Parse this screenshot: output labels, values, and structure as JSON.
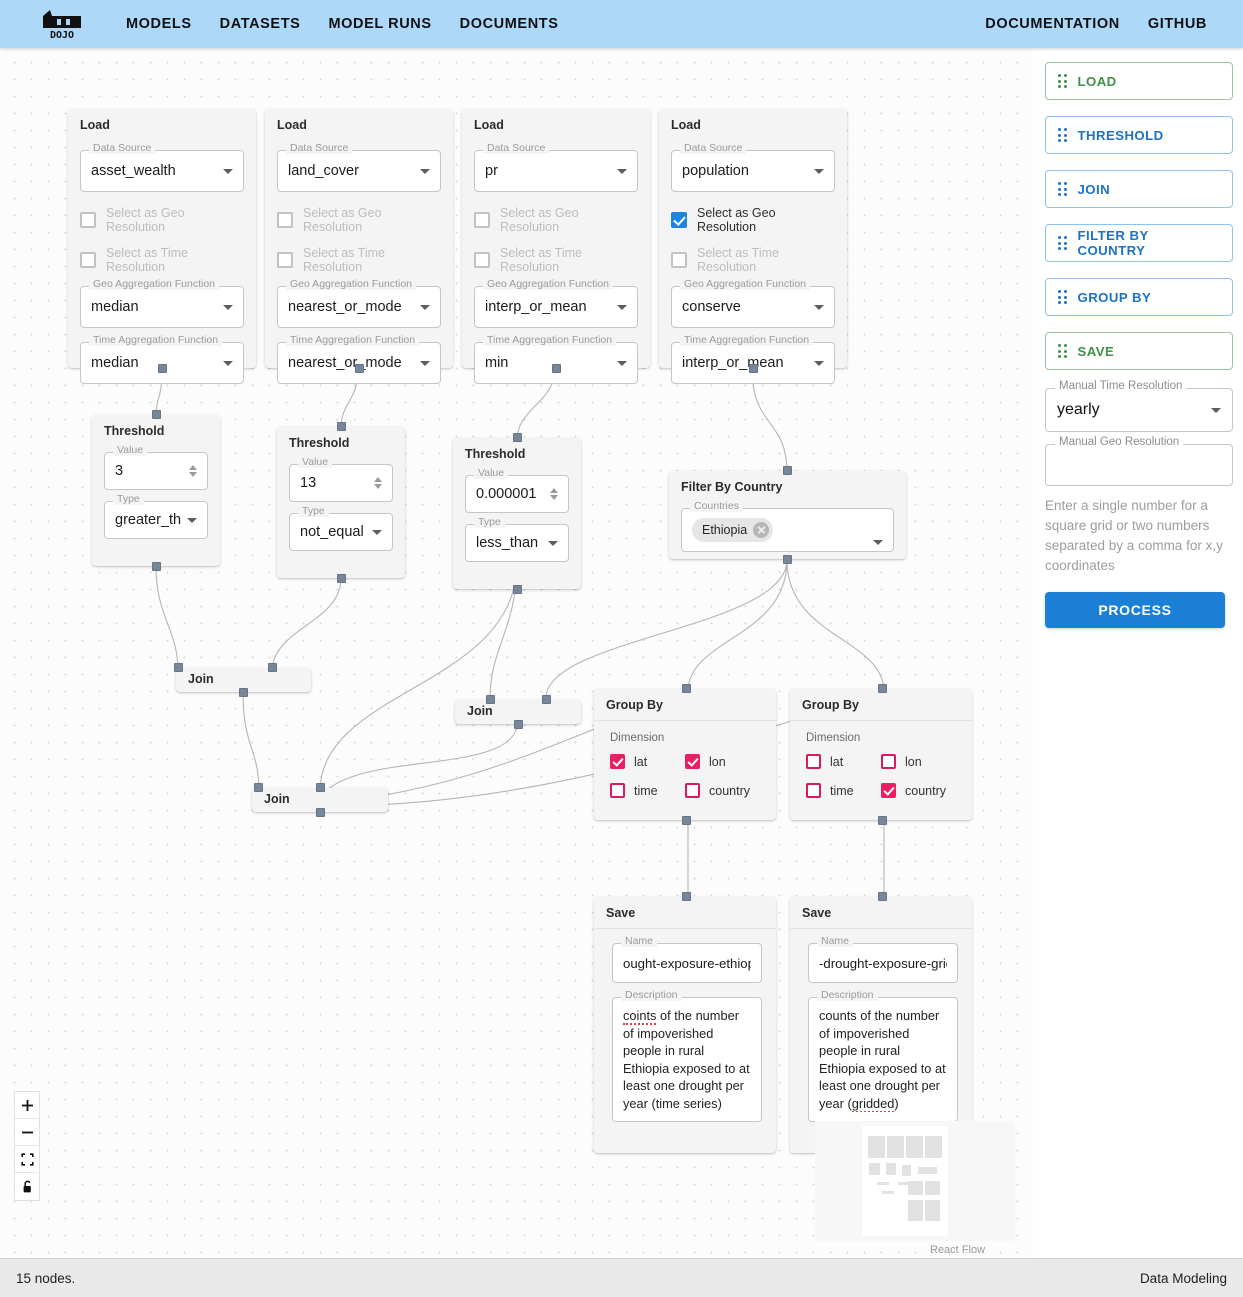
{
  "header": {
    "logo_alt": "DOJO",
    "nav_left": [
      "MODELS",
      "DATASETS",
      "MODEL RUNS",
      "DOCUMENTS"
    ],
    "nav_right": [
      "DOCUMENTATION",
      "GITHUB"
    ],
    "bg_color": "#aed8f7"
  },
  "sidebar": {
    "palette": [
      {
        "label": "LOAD",
        "tone": "green"
      },
      {
        "label": "THRESHOLD",
        "tone": "blue"
      },
      {
        "label": "JOIN",
        "tone": "blue"
      },
      {
        "label": "FILTER BY COUNTRY",
        "tone": "blue"
      },
      {
        "label": "GROUP BY",
        "tone": "blue"
      },
      {
        "label": "SAVE",
        "tone": "green"
      }
    ],
    "time_resolution": {
      "label": "Manual Time Resolution",
      "value": "yearly"
    },
    "geo_resolution": {
      "label": "Manual Geo Resolution",
      "value": "",
      "placeholder": ""
    },
    "help_text": "Enter a single number for a square grid or two numbers separated by a comma for x,y coordinates",
    "process_label": "PROCESS",
    "process_color": "#1c7fd6"
  },
  "canvas": {
    "field_labels": {
      "data_source": "Data Source",
      "geo_res": "Select as Geo Resolution",
      "time_res": "Select as Time Resolution",
      "geo_agg": "Geo Aggregation Function",
      "time_agg": "Time Aggregation Function",
      "value": "Value",
      "type": "Type",
      "countries": "Countries",
      "dimension": "Dimension",
      "name": "Name",
      "description": "Description"
    },
    "load_nodes": [
      {
        "title": "Load",
        "data_source": "asset_wealth",
        "geo_checked": false,
        "time_checked": false,
        "geo_agg": "median",
        "time_agg": "median"
      },
      {
        "title": "Load",
        "data_source": "land_cover",
        "geo_checked": false,
        "time_checked": false,
        "geo_agg": "nearest_or_mode",
        "time_agg": "nearest_or_mode"
      },
      {
        "title": "Load",
        "data_source": "pr",
        "geo_checked": false,
        "time_checked": false,
        "geo_agg": "interp_or_mean",
        "time_agg": "min"
      },
      {
        "title": "Load",
        "data_source": "population",
        "geo_checked": true,
        "time_checked": false,
        "geo_agg": "conserve",
        "time_agg": "interp_or_mean"
      }
    ],
    "threshold_nodes": [
      {
        "title": "Threshold",
        "value": "3",
        "type": "greater_than_"
      },
      {
        "title": "Threshold",
        "value": "13",
        "type": "not_equal"
      },
      {
        "title": "Threshold",
        "value": "0.000001",
        "type": "less_than"
      }
    ],
    "filter_node": {
      "title": "Filter By Country",
      "country": "Ethiopia"
    },
    "join_nodes": [
      {
        "title": "Join"
      },
      {
        "title": "Join"
      },
      {
        "title": "Join"
      }
    ],
    "group_by_nodes": [
      {
        "title": "Group By",
        "dims": [
          {
            "label": "lat",
            "on": true
          },
          {
            "label": "lon",
            "on": true
          },
          {
            "label": "time",
            "on": false
          },
          {
            "label": "country",
            "on": false
          }
        ]
      },
      {
        "title": "Group By",
        "dims": [
          {
            "label": "lat",
            "on": false
          },
          {
            "label": "lon",
            "on": false
          },
          {
            "label": "time",
            "on": false
          },
          {
            "label": "country",
            "on": true
          }
        ]
      }
    ],
    "save_nodes": [
      {
        "title": "Save",
        "name": "ought-exposure-ethiopia-ti",
        "desc_misspelled": "coints",
        "desc_rest": " of the number of impoverished people in rural Ethiopia exposed to at least one drought per year (time series)"
      },
      {
        "title": "Save",
        "name": "-drought-exposure-gridded",
        "desc_lead": "counts of the number of impoverished people in rural Ethiopia exposed to at least one drought per year (",
        "desc_misspelled": "gridded",
        "desc_tail": ")"
      }
    ],
    "controls": [
      "zoom-in",
      "zoom-out",
      "fit-view",
      "lock"
    ],
    "attribution": "React Flow"
  },
  "statusbar": {
    "left": "15 nodes.",
    "right": "Data Modeling"
  }
}
